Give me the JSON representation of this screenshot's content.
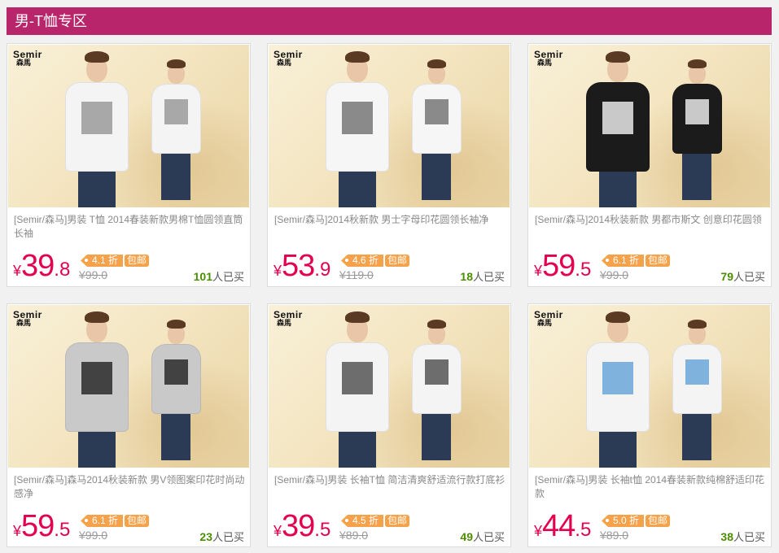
{
  "section_title": "男-T恤专区",
  "brand": {
    "name_en": "Semir",
    "name_cn": "森馬"
  },
  "currency_symbol": "¥",
  "sold_suffix": "人已买",
  "free_shipping_label": "包邮",
  "products": [
    {
      "title": "[Semir/森马]男装 T恤 2014春装新款男棉T恤圆领直筒长袖",
      "price_int": "39",
      "price_dec": ".8",
      "discount": "4.1 折",
      "original_price": "¥99.0",
      "sold": "101",
      "shirt_color": "#f4f4f4",
      "print_color": "#9a9a9a"
    },
    {
      "title": "[Semir/森马]2014秋新款 男士字母印花圆领长袖净",
      "price_int": "53",
      "price_dec": ".9",
      "discount": "4.6 折",
      "original_price": "¥119.0",
      "sold": "18",
      "shirt_color": "#f6f6f6",
      "print_color": "#777777"
    },
    {
      "title": "[Semir/森马]2014秋装新款 男都市斯文 创意印花圆领",
      "price_int": "59",
      "price_dec": ".5",
      "discount": "6.1 折",
      "original_price": "¥99.0",
      "sold": "79",
      "shirt_color": "#1b1b1b",
      "print_color": "#e8e8e8"
    },
    {
      "title": "[Semir/森马]森马2014秋装新款 男V领图案印花时尚动感净",
      "price_int": "59",
      "price_dec": ".5",
      "discount": "6.1 折",
      "original_price": "¥99.0",
      "sold": "23",
      "shirt_color": "#c9c9c9",
      "print_color": "#2a2a2a"
    },
    {
      "title": "[Semir/森马]男装 长袖T恤 简洁清爽舒适流行款打底衫",
      "price_int": "39",
      "price_dec": ".5",
      "discount": "4.5 折",
      "original_price": "¥89.0",
      "sold": "49",
      "shirt_color": "#f4f4f4",
      "print_color": "#555555"
    },
    {
      "title": "[Semir/森马]男装 长袖t恤 2014春装新款纯棉舒适印花款",
      "price_int": "44",
      "price_dec": ".5",
      "discount": "5.0 折",
      "original_price": "¥89.0",
      "sold": "38",
      "shirt_color": "#f4f4f4",
      "print_color": "#6aa6d8"
    }
  ]
}
